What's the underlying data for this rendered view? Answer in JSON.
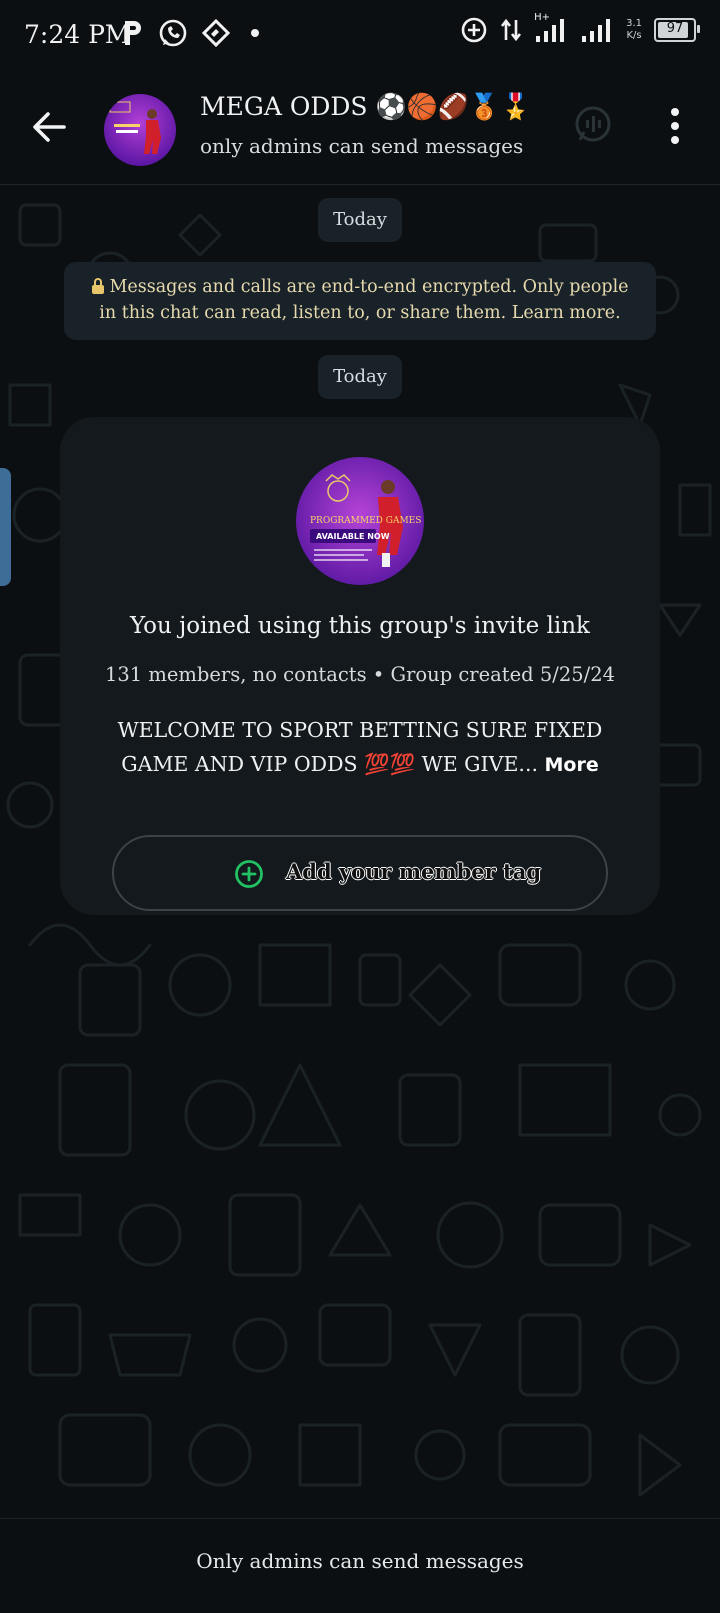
{
  "status_bar": {
    "time": "7:24 PM",
    "network_speed_value": "3.1",
    "network_speed_unit": "K/s",
    "network_type": "H+",
    "battery_level": "97",
    "icons": [
      "parking-p-icon",
      "whatsapp-icon",
      "app-icon",
      "dot-icon",
      "data-saver-icon",
      "data-transfer-icon",
      "signal-icon",
      "signal-icon",
      "battery-icon"
    ]
  },
  "header": {
    "group_name": "MEGA ODDS ⚽🏀🏈🥉🎖️",
    "subtitle": "only admins can send messages",
    "icons": [
      "back-arrow-icon",
      "group-avatar",
      "call-icon",
      "more-vert-icon"
    ]
  },
  "chat": {
    "date_chip_1": "Today",
    "encryption_notice": "Messages and calls are end-to-end encrypted. Only people in this chat can read, listen to, or share them. Learn more.",
    "date_chip_2": "Today",
    "card": {
      "avatar_text_1": "PROGRAMMED GAMES",
      "avatar_text_2": "AVAILABLE NOW",
      "joined_text": "You joined using this group's invite link",
      "meta_text": "131 members, no contacts • Group created 5/25/24",
      "description_line_1": "WELCOME TO SPORT BETTING SURE FIXED",
      "description_line_2": "GAME AND VIP ODDS 💯💯  WE GIVE...",
      "more_label": "More",
      "tag_button_label": "Add your member tag"
    }
  },
  "bottom_bar": {
    "text": "Only admins can send messages"
  },
  "colors": {
    "background": "#0b0f12",
    "bubble": "#182228",
    "card": "#13191c",
    "accent_green": "#21c063",
    "encryption_text": "#e7d9ae"
  }
}
